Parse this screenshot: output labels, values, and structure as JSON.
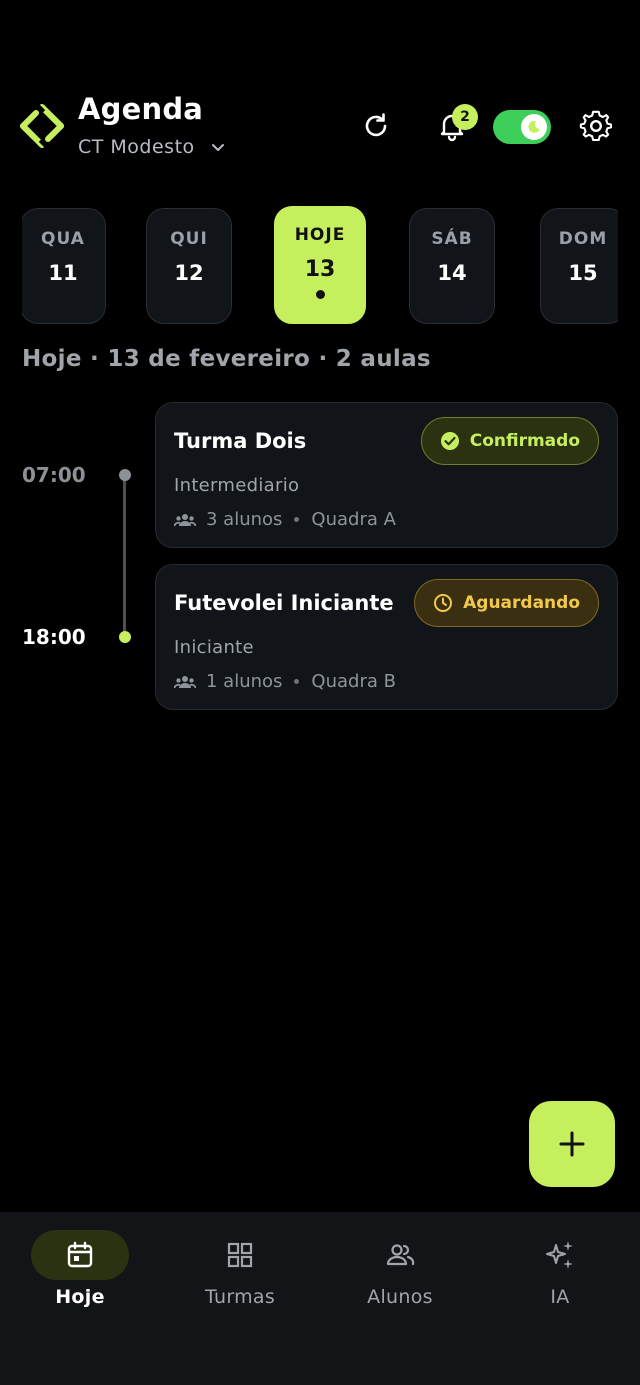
{
  "header": {
    "title": "Agenda",
    "center_name": "CT Modesto",
    "notifications_count": "2",
    "theme_toggle_on": true,
    "icons": [
      "logo-icon",
      "chevron-down-icon",
      "refresh-icon",
      "bell-icon",
      "moon-icon",
      "gear-icon"
    ]
  },
  "days": [
    {
      "name": "QUA",
      "num": "11",
      "active": false
    },
    {
      "name": "QUI",
      "num": "12",
      "active": false
    },
    {
      "name": "HOJE",
      "num": "13",
      "active": true,
      "has_dot": true
    },
    {
      "name": "SÁB",
      "num": "14",
      "active": false
    },
    {
      "name": "DOM",
      "num": "15",
      "active": false
    }
  ],
  "date_summary": "Hoje · 13 de fevereiro · 2 aulas",
  "classes": [
    {
      "time": "07:00",
      "title": "Turma Dois",
      "level": "Intermediario",
      "students": "3 alunos",
      "court": "Quadra A",
      "status": "Confirmado",
      "status_color": "#c6ef5e"
    },
    {
      "time": "18:00",
      "title": "Futevolei Iniciante",
      "level": "Iniciante",
      "students": "1 alunos",
      "court": "Quadra B",
      "status": "Aguardando",
      "status_color": "#f2c94c"
    }
  ],
  "fab": {
    "icon": "plus-icon"
  },
  "bottom_nav": [
    {
      "label": "Hoje",
      "icon": "calendar-icon",
      "active": true
    },
    {
      "label": "Turmas",
      "icon": "grid-icon",
      "active": false
    },
    {
      "label": "Alunos",
      "icon": "users-icon",
      "active": false
    },
    {
      "label": "IA",
      "icon": "sparkles-icon",
      "active": false
    }
  ],
  "colors": {
    "accent": "#c6ef5e",
    "background": "#000000",
    "card": "#111418",
    "warning": "#f2c94c",
    "toggle": "#3dcf5a"
  }
}
